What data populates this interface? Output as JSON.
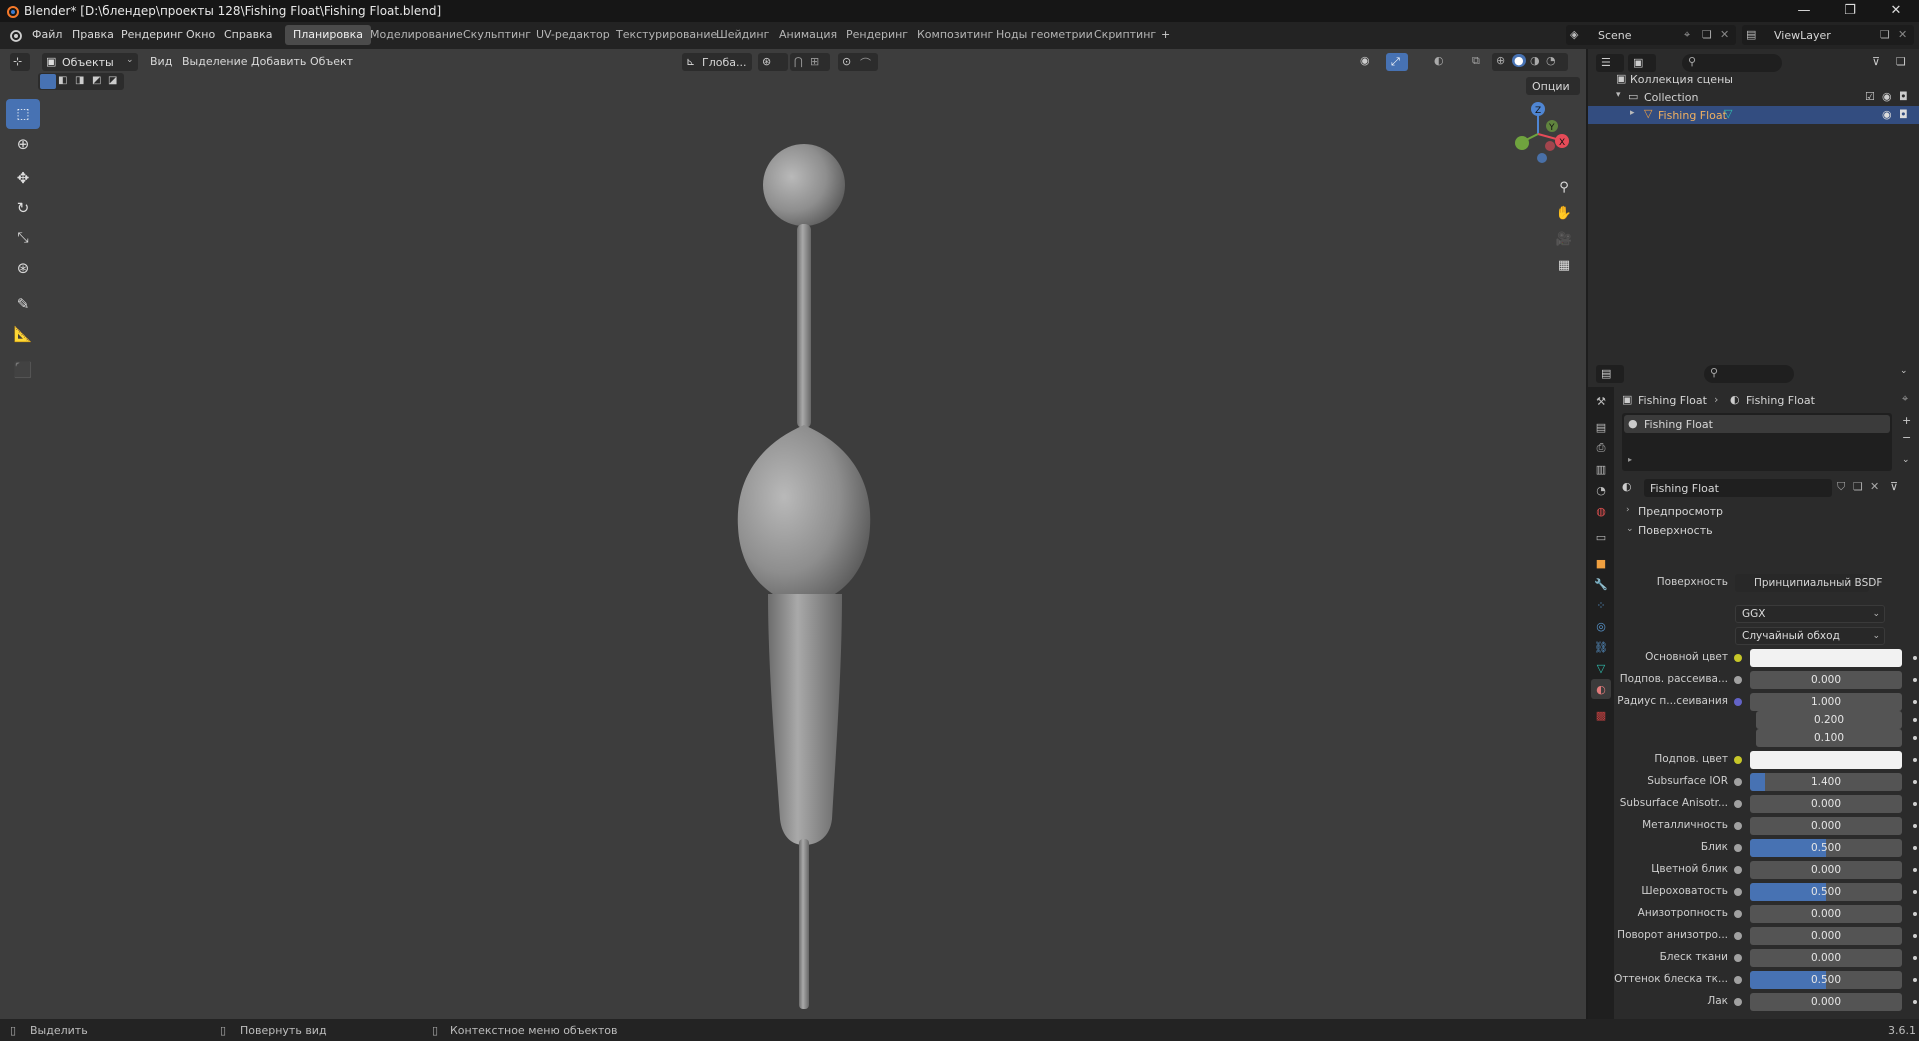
{
  "window": {
    "title": "Blender* [D:\\блендер\\проекты 128\\Fishing Float\\Fishing Float.blend]",
    "minimize": "—",
    "maximize": "❐",
    "close": "✕"
  },
  "menu": {
    "items": [
      "Файл",
      "Правка",
      "Рендеринг",
      "Окно",
      "Справка"
    ]
  },
  "workspaces": {
    "tabs": [
      "Планировка",
      "Моделирование",
      "Скульптинг",
      "UV-редактор",
      "Текстурирование",
      "Шейдинг",
      "Анимация",
      "Рендеринг",
      "Композитинг",
      "Ноды геометрии",
      "Скриптинг"
    ],
    "active": "Планировка",
    "add": "+"
  },
  "scene": {
    "name": "Scene",
    "view_layer": "ViewLayer"
  },
  "viewport": {
    "mode": "Объекты",
    "menus": [
      "Вид",
      "Выделение",
      "Добавить",
      "Объект"
    ],
    "transform_orientation": "Глоба...",
    "options": "Опции",
    "gizmo": {
      "x": "X",
      "y": "Y",
      "z": "Z"
    }
  },
  "tools": [
    "select-box",
    "cursor",
    "move",
    "rotate",
    "scale",
    "transform",
    "annotate",
    "measure",
    "add-cube"
  ],
  "outliner": {
    "root": "Коллекция сцены",
    "collection": "Collection",
    "object": "Fishing Float"
  },
  "properties": {
    "breadcrumb": [
      "Fishing Float",
      "Fishing Float"
    ],
    "material_slot": "Fishing Float",
    "material_name": "Fishing Float",
    "panels": {
      "preview": "Предпросмотр",
      "surface": "Поверхность"
    },
    "surface_label": "Поверхность",
    "surface_shader": "Принципиальный BSDF",
    "distribution": "GGX",
    "subsurface_method": "Случайный обход",
    "rows": [
      {
        "label": "Основной цвет",
        "type": "color",
        "color": "#f2f2f2",
        "socket": "#c7c729"
      },
      {
        "label": "Подпов. рассеива...",
        "value": "0.000",
        "fill": 0.0,
        "socket": "#a1a1a1"
      },
      {
        "label": "Радиус п...сеивания",
        "value": "1.000",
        "fill": 0.0,
        "socket": "#6363c7"
      },
      {
        "label": "",
        "value": "0.200",
        "fill": 0.0,
        "socket": ""
      },
      {
        "label": "",
        "value": "0.100",
        "fill": 0.0,
        "socket": ""
      },
      {
        "label": "Подпов. цвет",
        "type": "color",
        "color": "#f2f2f2",
        "socket": "#c7c729"
      },
      {
        "label": "Subsurface IOR",
        "value": "1.400",
        "fill": 0.1,
        "socket": "#a1a1a1"
      },
      {
        "label": "Subsurface Anisotr...",
        "value": "0.000",
        "fill": 0.0,
        "socket": "#a1a1a1"
      },
      {
        "label": "Металличность",
        "value": "0.000",
        "fill": 0.0,
        "socket": "#a1a1a1"
      },
      {
        "label": "Блик",
        "value": "0.500",
        "fill": 0.5,
        "socket": "#a1a1a1"
      },
      {
        "label": "Цветной блик",
        "value": "0.000",
        "fill": 0.0,
        "socket": "#a1a1a1"
      },
      {
        "label": "Шероховатость",
        "value": "0.500",
        "fill": 0.5,
        "socket": "#a1a1a1"
      },
      {
        "label": "Анизотропность",
        "value": "0.000",
        "fill": 0.0,
        "socket": "#a1a1a1"
      },
      {
        "label": "Поворот анизотро...",
        "value": "0.000",
        "fill": 0.0,
        "socket": "#a1a1a1"
      },
      {
        "label": "Блеск ткани",
        "value": "0.000",
        "fill": 0.0,
        "socket": "#a1a1a1"
      },
      {
        "label": "Оттенок блеска тк...",
        "value": "0.500",
        "fill": 0.5,
        "socket": "#a1a1a1"
      },
      {
        "label": "Лак",
        "value": "0.000",
        "fill": 0.0,
        "socket": "#a1a1a1"
      }
    ]
  },
  "statusbar": {
    "select": "Выделить",
    "rotate_view": "Повернуть вид",
    "context_menu": "Контекстное меню объектов",
    "version": "3.6.1"
  },
  "colors": {
    "accent": "#4772b3",
    "viewport_bg": "#3d3d3d",
    "panel_bg": "#2b2b2b",
    "selected_row": "#334d80"
  }
}
